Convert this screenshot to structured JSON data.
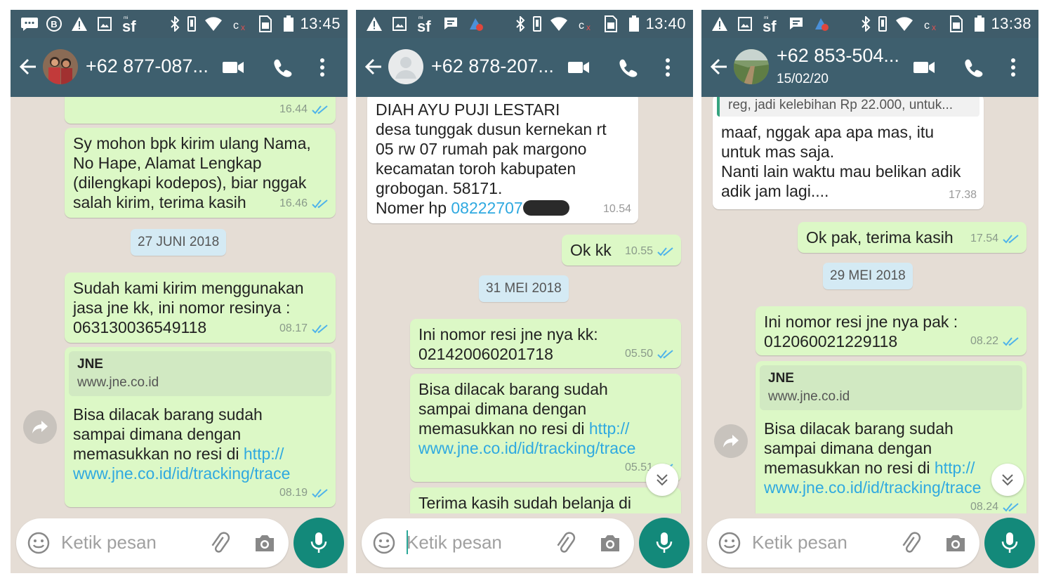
{
  "screens": [
    {
      "status_time": "13:45",
      "contact_name": "+62 877-087...",
      "contact_sub": "",
      "messages": {
        "m0_time": "16.44",
        "m1_text": "Sy mohon bpk kirim ulang Nama,\nNo Hape, Alamat Lengkap\n(dilengkapi kodepos), biar nggak\nsalah kirim, terima kasih",
        "m1_time": "16.46",
        "date": "27 JUNI 2018",
        "m2_text": "Sudah kami kirim menggunakan\njasa jne kk, ini nomor resinya :\n063130036549118",
        "m2_time": "08.17",
        "preview_title": "JNE",
        "preview_url": "www.jne.co.id",
        "m3_text": "Bisa dilacak barang sudah\nsampai dimana dengan\nmemasukkan no resi di ",
        "m3_link": "http://\nwww.jne.co.id/id/tracking/trace",
        "m3_time": "08.19"
      },
      "input_placeholder": "Ketik pesan"
    },
    {
      "status_time": "13:40",
      "contact_name": "+62 878-207...",
      "contact_sub": "",
      "messages": {
        "in_text": "DIAH AYU PUJI LESTARI\ndesa tunggak dusun kernekan rt\n05 rw 07 rumah pak margono\nkecamatan toroh kabupaten\ngrobogan. 58171.",
        "in_phone_label": " Nomer hp ",
        "in_phone": "08222707",
        "in_time": "10.54",
        "ok_text": "Ok kk",
        "ok_time": "10.55",
        "date": "31 MEI 2018",
        "resi_text": "Ini nomor resi jne nya kk:\n021420060201718",
        "resi_time": "05.50",
        "track_text": "Bisa dilacak barang sudah\nsampai dimana dengan\nmemasukkan no resi di ",
        "track_link": "http://\nwww.jne.co.id/id/tracking/trace",
        "track_time": "05.51",
        "thanks_text": "Terima kasih sudah belanja di"
      },
      "input_placeholder": "Ketik pesan"
    },
    {
      "status_time": "13:38",
      "contact_name": "+62 853-504...",
      "contact_sub": "15/02/20",
      "messages": {
        "quote_text": "reg, jadi kelebihan Rp 22.000, untuk...",
        "in_text": "maaf, nggak apa apa mas, itu\nuntuk mas saja.\nNanti lain waktu mau belikan adik\nadik jam lagi....",
        "in_time": "17.38",
        "ok_text": "Ok pak, terima kasih",
        "ok_time": "17.54",
        "date": "29 MEI 2018",
        "resi_text": "Ini nomor resi jne nya pak :\n012060021229118",
        "resi_time": "08.22",
        "preview_title": "JNE",
        "preview_url": "www.jne.co.id",
        "track_text": "Bisa dilacak barang sudah\nsampai dimana dengan\nmemasukkan no resi di ",
        "track_link": "http://\nwww.jne.co.id/id/tracking/trace",
        "track_time": "08.24"
      },
      "input_placeholder": "Ketik pesan"
    }
  ],
  "colors": {
    "status_bar": "#3f5c6a",
    "header": "#3e5f6e",
    "chat_bg": "#e5ddd5",
    "bubble_out": "#dcf8c6",
    "bubble_in": "#ffffff",
    "tick_read": "#4fb3ea",
    "link": "#2fa9e0",
    "mic_button": "#13897a"
  }
}
